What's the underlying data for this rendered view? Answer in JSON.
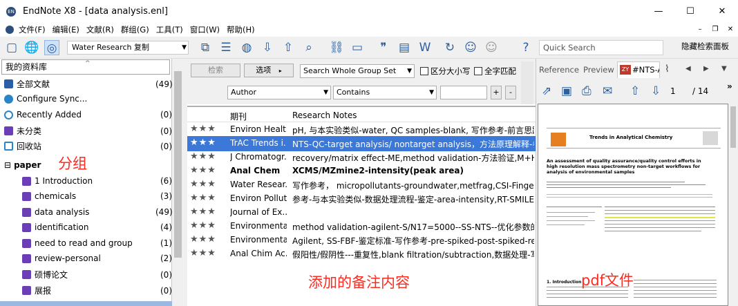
{
  "window": {
    "title": "EndNote X8 - [data analysis.enl]",
    "app_icon": "EN",
    "minimize": "—",
    "maximize": "☐",
    "close": "✕"
  },
  "menu": {
    "items": [
      "文件(F)",
      "编辑(E)",
      "文献(R)",
      "群组(G)",
      "工具(T)",
      "窗口(W)",
      "帮助(H)"
    ],
    "mdi_min": "–",
    "mdi_restore": "❐",
    "mdi_close": "✕"
  },
  "toolbar": {
    "style_select": "Water Research 复制",
    "quick_search_placeholder": "Quick Search",
    "hide_panel": "隐藏检索面板"
  },
  "library": {
    "header": "我的资料库",
    "groups": [
      {
        "label": "全部文献",
        "count": "(49)",
        "color": "#2a5fa8"
      },
      {
        "label": "Configure Sync...",
        "count": "",
        "color": "#2a85c8"
      },
      {
        "label": "Recently Added",
        "count": "(0)",
        "color": "#2a85c8"
      },
      {
        "label": "未分类",
        "count": "(0)",
        "color": "#6a3fb5"
      },
      {
        "label": "回收站",
        "count": "(0)",
        "color": "#2a85c8"
      }
    ],
    "group_set": "paper",
    "subgroups": [
      {
        "label": "1 Introduction",
        "count": "(6)"
      },
      {
        "label": "chemicals",
        "count": "(3)"
      },
      {
        "label": "data analysis",
        "count": "(49)"
      },
      {
        "label": "identification",
        "count": "(4)"
      },
      {
        "label": "need to read and group",
        "count": "(1)"
      },
      {
        "label": "review-personal",
        "count": "(2)"
      },
      {
        "label": "硕博论文",
        "count": "(0)"
      },
      {
        "label": "展报",
        "count": "(0)"
      }
    ]
  },
  "search": {
    "search_btn": "检索",
    "options_btn": "选项",
    "scope": "Search Whole Group Set",
    "case": "区分大小写",
    "whole_word": "全字匹配",
    "field": "Author",
    "op": "Contains",
    "plus": "+",
    "minus": "-"
  },
  "table": {
    "headers": {
      "journal": "期刊",
      "notes": "Research Notes"
    },
    "rows": [
      {
        "stars": "★★★",
        "journal": "Environ Healt...",
        "notes": "pH, 与本实验类似-water, QC samples-blank, 写作参考-前言思路"
      },
      {
        "stars": "★★★",
        "journal": "TrAC Trends i...",
        "notes": "NTS-QC-target analysis/ nontarget analysis，方法原理解释-参考"
      },
      {
        "stars": "★★★",
        "journal": "J Chromatogr...",
        "notes": "recovery/matrix effect-ME,method validation-方法验证,M+H，M"
      },
      {
        "stars": "★★★",
        "journal": "Anal Chem",
        "notes": "XCMS/MZmine2-intensity(peak area)"
      },
      {
        "stars": "★★★",
        "journal": "Water Resear...",
        "notes": "写作参考， micropollutants-groundwater,metfrag,CSI-FingerID-M"
      },
      {
        "stars": "★★★",
        "journal": "Environ Pollut",
        "notes": "参考-与本实验类似-数据处理流程-鉴定-area-intensity,RT-SMILE"
      },
      {
        "stars": "★★★",
        "journal": "Journal of Ex...",
        "notes": ""
      },
      {
        "stars": "★★★",
        "journal": "Environmenta...",
        "notes": "method validation-agilent-S/N17=5000--SS-NTS--优化参数的依"
      },
      {
        "stars": "★★★",
        "journal": "Environmenta...",
        "notes": "Agilent, SS-FBF-鉴定标准-写作参考-pre-spiked-post-spiked-refe"
      },
      {
        "stars": "★★★",
        "journal": "Anal Chim Ac...",
        "notes": "假阳性/假阴性---重复性,blank filtration/subtraction,数据处理-写"
      }
    ]
  },
  "right": {
    "tab_reference": "Reference",
    "tab_preview": "Preview",
    "tab_pdf": "#NTS-Ar",
    "page_current": "1",
    "page_total": "/ 14",
    "more": "»"
  },
  "pdf": {
    "journal": "Trends in Analytical Chemistry",
    "title": "An assessment of quality assurance/quality control efforts in high resolution mass spectrometry non-target workflows for analysis of environmental samples",
    "section": "1. Introduction"
  },
  "annotations": {
    "groups": "分组",
    "notes": "添加的备注内容",
    "pdf": "pdf文件"
  }
}
